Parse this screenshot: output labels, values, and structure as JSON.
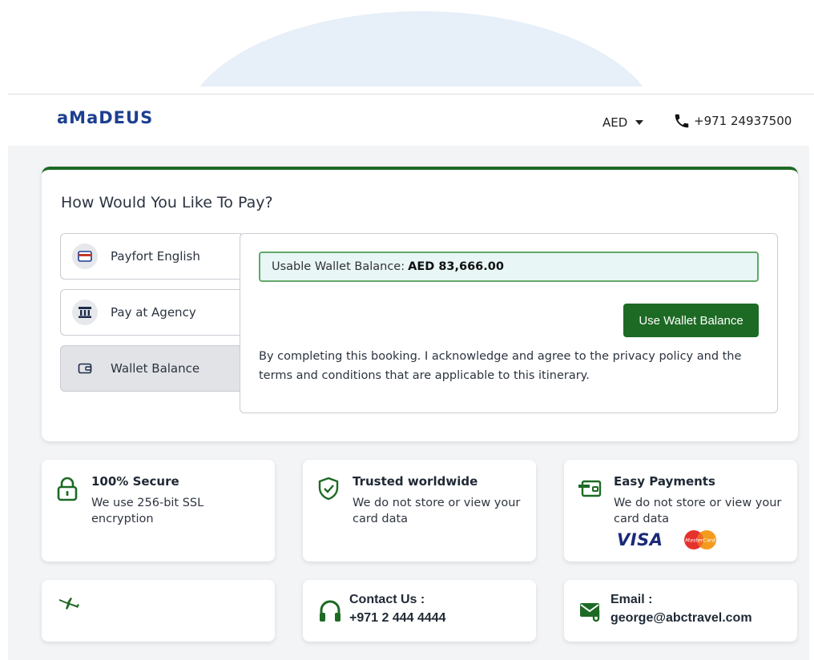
{
  "header": {
    "logo": "aMaDEUS",
    "currency": "AED",
    "phone": "+971 24937500"
  },
  "payment": {
    "title": "How Would You Like To Pay?",
    "options": [
      {
        "label": "Payfort English",
        "icon": "credit-card-icon",
        "selected": false
      },
      {
        "label": "Pay at Agency",
        "icon": "bank-icon",
        "selected": false
      },
      {
        "label": "Wallet Balance",
        "icon": "wallet-icon",
        "selected": true
      }
    ],
    "wallet_label": "Usable Wallet Balance:",
    "wallet_amount": "AED 83,666.00",
    "use_button": "Use Wallet Balance",
    "terms": "By completing this booking. I acknowledge and agree to the privacy policy and the terms and conditions that are applicable to this itinerary."
  },
  "features": [
    {
      "title": "100% Secure",
      "desc": "We use 256-bit SSL encryption",
      "icon": "lock-icon"
    },
    {
      "title": "Trusted worldwide",
      "desc": "We do not store or view your card data",
      "icon": "shield-check-icon"
    },
    {
      "title": "Easy Payments",
      "desc": "We do not store or view your card data",
      "icon": "wallet-card-icon",
      "visa": "VISA",
      "mastercard": "MasterCard"
    }
  ],
  "contact": {
    "icon": "plane-icon",
    "phone_label": "Contact Us :",
    "phone_value": "+971 2 444 4444",
    "email_label": "Email :",
    "email_value": "george@abctravel.com"
  },
  "colors": {
    "brand_green": "#1d6a24",
    "logo_blue": "#1c3f8f",
    "arc": "#e7eff8",
    "wallet_bg": "#e8f6f6"
  }
}
